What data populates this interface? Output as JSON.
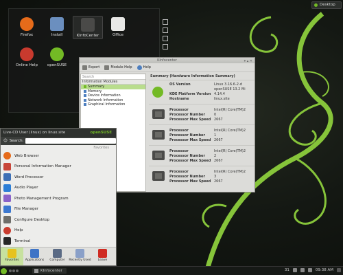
{
  "desktop": {
    "toolbox_label": "Desktop",
    "icons": [
      {
        "label": "Firefox",
        "icon": "firefox-icon",
        "color": "#e66b1a"
      },
      {
        "label": "Install",
        "icon": "install-icon",
        "color": "#6b8fbf"
      },
      {
        "label": "KInfoCenter",
        "icon": "kinfocenter-icon",
        "color": "#4a4a48"
      },
      {
        "label": "Office",
        "icon": "office-icon",
        "color": "#e8e8e6"
      },
      {
        "label": "Online Help",
        "icon": "online-help-icon",
        "color": "#c83a2e"
      },
      {
        "label": "openSUSE",
        "icon": "opensuse-icon",
        "color": "#73ba25"
      }
    ]
  },
  "kinfocenter": {
    "title": "KInfocenter",
    "toolbar": {
      "export_label": "Export",
      "module_help_label": "Module Help",
      "help_label": "Help"
    },
    "search_placeholder": "Search",
    "modules_header": "Information Modules",
    "modules": [
      "Summary",
      "Memory",
      "Device Information",
      "Network Information",
      "Graphical Information"
    ],
    "active_module": "Summary",
    "summary_title": "Summary (Hardware Information Summary)",
    "os_block": {
      "rows": [
        {
          "key": "OS Version",
          "value": "Linux 3.16.6-2-d"
        },
        {
          "key": "",
          "value": "openSUSE 13.2 Mi"
        },
        {
          "key": "KDE Platform Version",
          "value": "4.14.4"
        },
        {
          "key": "Hostname",
          "value": "linux.site"
        }
      ]
    },
    "processors": [
      {
        "processor": "Intel(R) Core(TM)2",
        "number": "0",
        "max_speed": "2667"
      },
      {
        "processor": "Intel(R) Core(TM)2",
        "number": "1",
        "max_speed": "2667"
      },
      {
        "processor": "Intel(R) Core(TM)2",
        "number": "2",
        "max_speed": "2667"
      },
      {
        "processor": "Intel(R) Core(TM)2",
        "number": "3",
        "max_speed": "2667"
      }
    ],
    "processor_labels": {
      "processor": "Processor",
      "number": "Processor Number",
      "max_speed": "Processor Max Speed"
    }
  },
  "launcher": {
    "user_text": "Live-CD User (linux) on linux.site",
    "brand": "openSUSE",
    "search_label": "Search:",
    "favorites_label": "Favorites",
    "items": [
      {
        "label": "Web Browser",
        "icon": "web-browser-icon",
        "color": "#e66b1a"
      },
      {
        "label": "Personal Information Manager",
        "icon": "pim-icon",
        "color": "#c8463a"
      },
      {
        "label": "Word Processor",
        "icon": "word-processor-icon",
        "color": "#3d6fb5"
      },
      {
        "label": "Audio Player",
        "icon": "audio-player-icon",
        "color": "#2c7ed6"
      },
      {
        "label": "Photo Management Program",
        "icon": "photo-management-icon",
        "color": "#8a63c9"
      },
      {
        "label": "File Manager",
        "icon": "file-manager-icon",
        "color": "#3b78d0"
      },
      {
        "label": "Configure Desktop",
        "icon": "configure-desktop-icon",
        "color": "#6e6e6a"
      },
      {
        "label": "Help",
        "icon": "help-icon",
        "color": "#c93c2f"
      },
      {
        "label": "Terminal",
        "icon": "terminal-icon",
        "color": "#262626"
      }
    ],
    "tabs": [
      {
        "label": "Favorites",
        "icon": "star-icon",
        "color": "#e6c21e"
      },
      {
        "label": "Applications",
        "icon": "applications-icon",
        "color": "#3f74c6"
      },
      {
        "label": "Computer",
        "icon": "computer-icon",
        "color": "#5a6a84"
      },
      {
        "label": "Recently Used",
        "icon": "recently-used-icon",
        "color": "#8aa0c8"
      },
      {
        "label": "Leave",
        "icon": "leave-icon",
        "color": "#cf2b22"
      }
    ],
    "active_tab": "Favorites"
  },
  "taskbar": {
    "task_label": "KInfocenter",
    "tray_number": "31",
    "clock": "09:38 AM"
  },
  "colors": {
    "accent": "#73ba25",
    "highlight": "#b9dd8d"
  }
}
